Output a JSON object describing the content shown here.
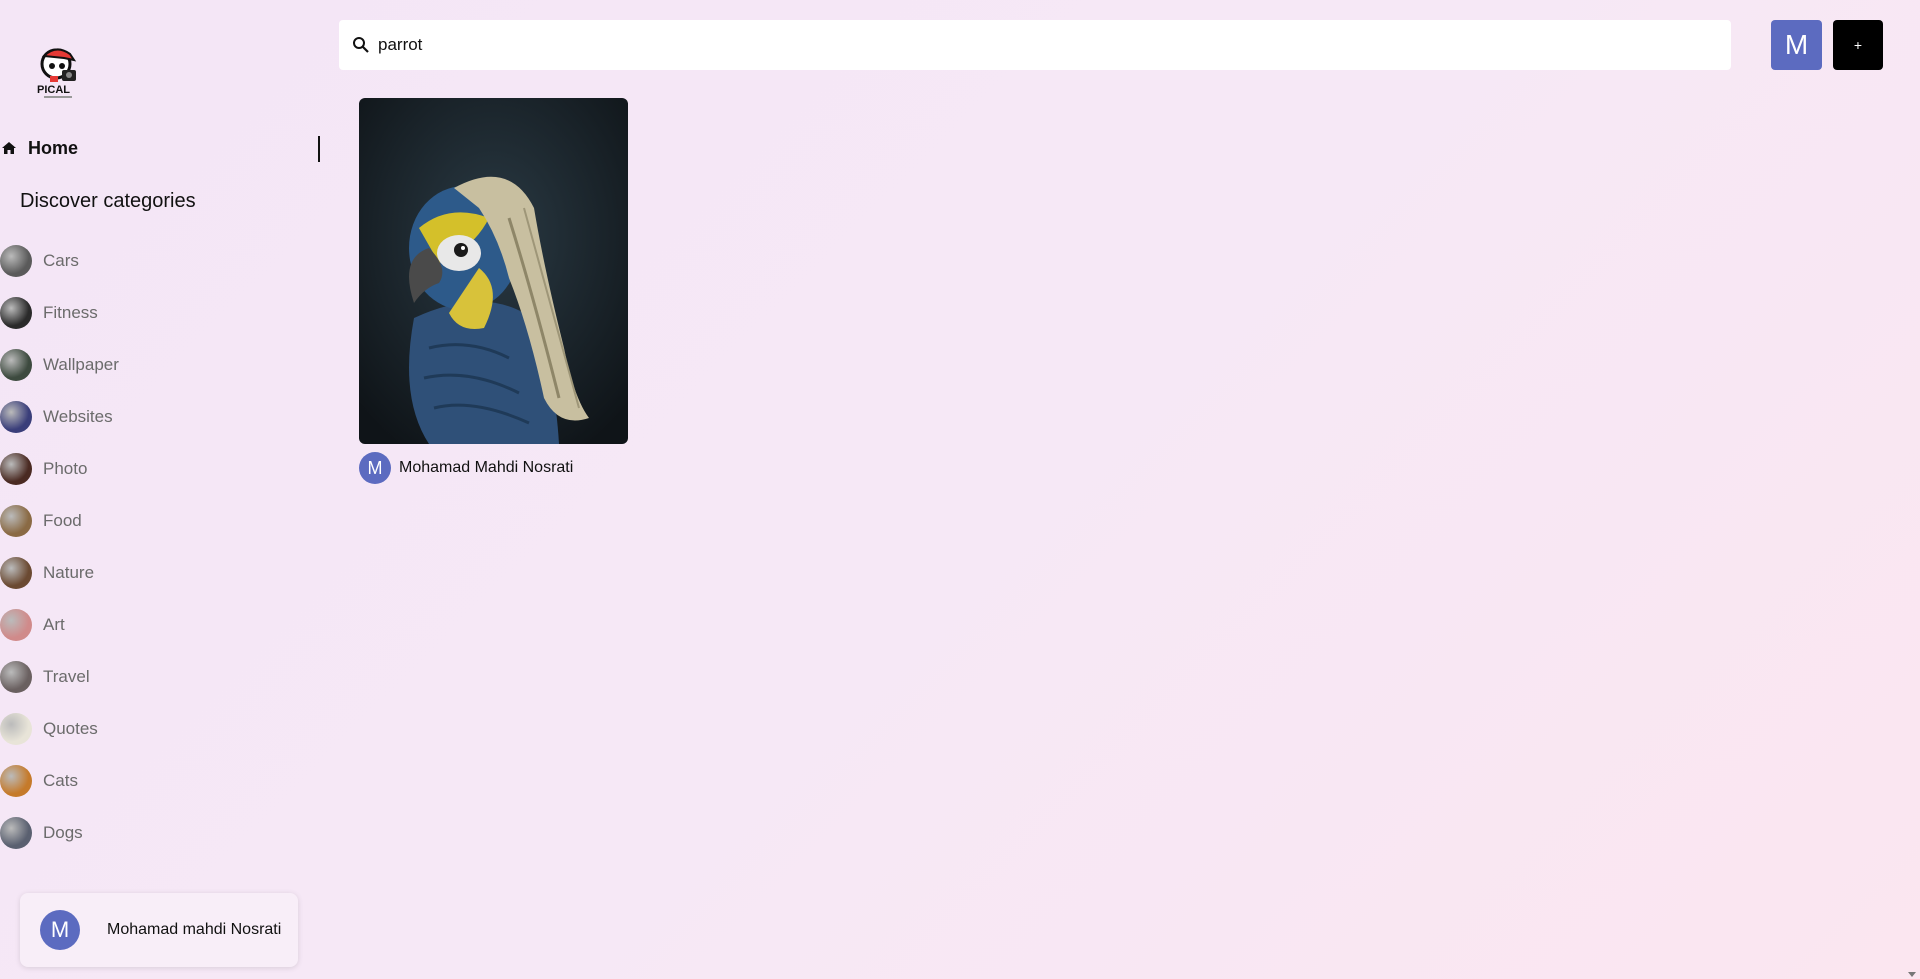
{
  "app": {
    "logo_text": "PICAL",
    "logo_icon": "camera-mascot-logo"
  },
  "search": {
    "value": "parrot",
    "icon": "search-icon"
  },
  "header": {
    "user_initial": "M",
    "add_label": "+"
  },
  "sidebar": {
    "home_label": "Home",
    "home_icon": "home-icon",
    "discover_title": "Discover categories",
    "categories": [
      {
        "label": "Cars",
        "color": "#5a5a5a"
      },
      {
        "label": "Fitness",
        "color": "#2a2a2a"
      },
      {
        "label": "Wallpaper",
        "color": "#3d4a3f"
      },
      {
        "label": "Websites",
        "color": "#3a3e7a"
      },
      {
        "label": "Photo",
        "color": "#4a2a22"
      },
      {
        "label": "Food",
        "color": "#8a6a44"
      },
      {
        "label": "Nature",
        "color": "#6b4a32"
      },
      {
        "label": "Art",
        "color": "#d08a8a"
      },
      {
        "label": "Travel",
        "color": "#6a6060"
      },
      {
        "label": "Quotes",
        "color": "#e8e4d8"
      },
      {
        "label": "Cats",
        "color": "#c57a2a"
      },
      {
        "label": "Dogs",
        "color": "#5a6070"
      }
    ]
  },
  "profile": {
    "initial": "M",
    "name": "Mohamad mahdi Nosrati"
  },
  "pins": [
    {
      "author_initial": "M",
      "author_name": "Mohamad Mahdi Nosrati"
    }
  ]
}
